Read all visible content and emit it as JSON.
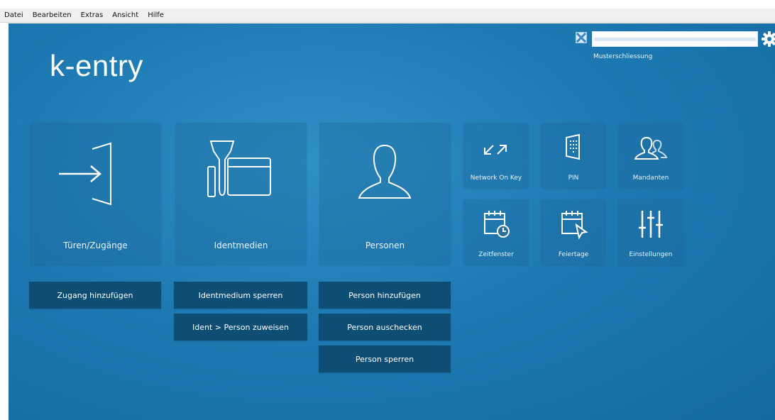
{
  "menu": {
    "items": [
      "Datei",
      "Bearbeiten",
      "Extras",
      "Ansicht",
      "Hilfe"
    ]
  },
  "app": {
    "logo": "k-entry"
  },
  "user": {
    "name": "Musterschliessung"
  },
  "tiles": {
    "doors": {
      "label": "Türen/Zugänge",
      "icon": "door-enter-icon"
    },
    "identmedia": {
      "label": "Identmedien",
      "icon": "key-card-icon"
    },
    "persons": {
      "label": "Personen",
      "icon": "person-icon"
    },
    "network_on_key": {
      "label": "Network On Key",
      "icon": "sync-arrows-icon"
    },
    "pin": {
      "label": "PIN",
      "icon": "keypad-icon"
    },
    "mandanten": {
      "label": "Mandanten",
      "icon": "users-icon"
    },
    "zeitfenster": {
      "label": "Zeitfenster",
      "icon": "calendar-clock-icon"
    },
    "feiertage": {
      "label": "Feiertage",
      "icon": "calendar-flag-icon"
    },
    "einstellungen": {
      "label": "Einstellungen",
      "icon": "sliders-icon"
    }
  },
  "actions": {
    "zugang_hinzufuegen": "Zugang hinzufügen",
    "identmedium_sperren": "Identmedium sperren",
    "ident_person_zuweisen": "Ident > Person zuweisen",
    "person_hinzufuegen": "Person hinzufügen",
    "person_auschecken": "Person auschecken",
    "person_sperren": "Person sperren"
  },
  "colors": {
    "background": "#1e7ab3",
    "tile": "#2a6f9e",
    "button": "#0e4e75",
    "text": "#ffffff"
  }
}
